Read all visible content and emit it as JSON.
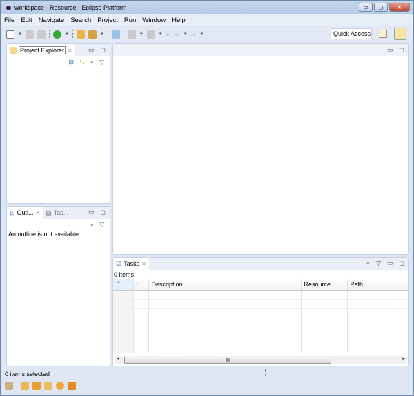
{
  "window": {
    "title": "workspace - Resource - Eclipse Platform",
    "minimize": "▭",
    "maximize": "◻",
    "close": "✕"
  },
  "menu": [
    "File",
    "Edit",
    "Navigate",
    "Search",
    "Project",
    "Run",
    "Window",
    "Help"
  ],
  "toolbar": {
    "quick_access": "Quick Access"
  },
  "project_explorer": {
    "tab": "Project Explorer"
  },
  "outline": {
    "tab": "Outl...",
    "tab2": "Tas...",
    "message": "An outline is not available."
  },
  "tasks": {
    "tab": "Tasks",
    "count": "0 items",
    "columns": [
      "",
      "!",
      "Description",
      "Resource",
      "Path"
    ],
    "scroll_grip": "III"
  },
  "status": {
    "text": "0 items selected"
  },
  "colors": {
    "frame": "#dfe6f3",
    "accent": "#f7e3a4"
  }
}
